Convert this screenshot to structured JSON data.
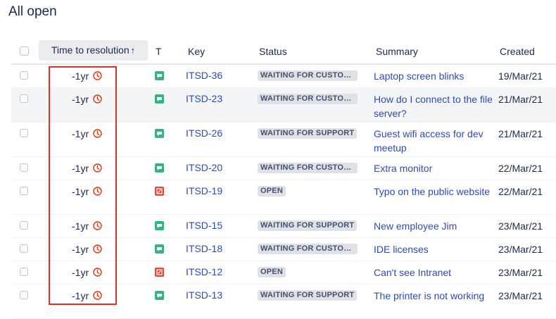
{
  "page": {
    "title": "All open"
  },
  "table": {
    "columns": {
      "time_to_resolution": "Time to resolution",
      "type": "T",
      "key": "Key",
      "status": "Status",
      "summary": "Summary",
      "created": "Created"
    },
    "sort_arrow": "↑",
    "rows": [
      {
        "time": "-1yr",
        "type": "service-request-icon",
        "key": "ITSD-36",
        "status": "WAITING FOR CUSTOMER",
        "summary": "Laptop screen blinks",
        "created": "19/Mar/21"
      },
      {
        "time": "-1yr",
        "type": "service-request-icon",
        "key": "ITSD-23",
        "status": "WAITING FOR CUSTOMER",
        "summary": "How do I connect to the file server?",
        "created": "21/Mar/21"
      },
      {
        "time": "-1yr",
        "type": "service-request-icon",
        "key": "ITSD-26",
        "status": "WAITING FOR SUPPORT",
        "summary": "Guest wifi access for dev meetup",
        "created": "21/Mar/21"
      },
      {
        "time": "-1yr",
        "type": "service-request-icon",
        "key": "ITSD-20",
        "status": "WAITING FOR CUSTOMER",
        "summary": "Extra monitor",
        "created": "22/Mar/21"
      },
      {
        "time": "-1yr",
        "type": "incident-icon",
        "key": "ITSD-19",
        "status": "OPEN",
        "summary": "Typo on the public website",
        "created": "22/Mar/21"
      },
      {
        "time": "-1yr",
        "type": "service-request-icon",
        "key": "ITSD-15",
        "status": "WAITING FOR SUPPORT",
        "summary": "New employee Jim",
        "created": "23/Mar/21"
      },
      {
        "time": "-1yr",
        "type": "service-request-icon",
        "key": "ITSD-18",
        "status": "WAITING FOR CUSTOMER",
        "summary": "IDE licenses",
        "created": "23/Mar/21"
      },
      {
        "time": "-1yr",
        "type": "incident-icon",
        "key": "ITSD-12",
        "status": "OPEN",
        "summary": "Can't see Intranet",
        "created": "23/Mar/21"
      },
      {
        "time": "-1yr",
        "type": "service-request-icon",
        "key": "ITSD-13",
        "status": "WAITING FOR SUPPORT",
        "summary": "The printer is not working",
        "created": "23/Mar/21"
      }
    ]
  },
  "colors": {
    "accent_link": "#2b4cb5",
    "breached_clock": "#de350b",
    "service_request": "#36b37e",
    "incident": "#e5493a",
    "highlight": "#d8322b"
  }
}
